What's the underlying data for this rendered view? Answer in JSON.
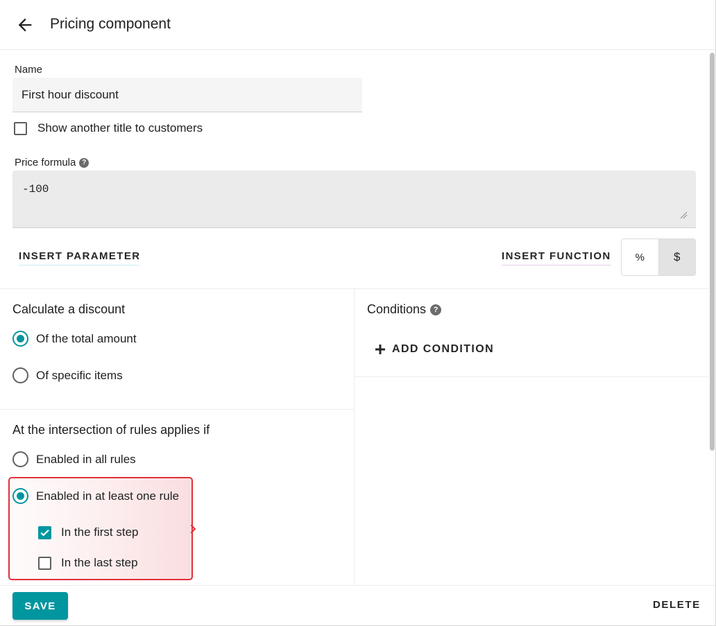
{
  "header": {
    "title": "Pricing component",
    "back_icon": "arrow-left-icon"
  },
  "name_field": {
    "label": "Name",
    "value": "First hour discount"
  },
  "show_title_option": {
    "label": "Show another title to customers",
    "checked": false
  },
  "price_formula": {
    "label": "Price formula",
    "help_icon": "question-circle-icon",
    "value": "-100"
  },
  "actions": {
    "insert_parameter": "INSERT PARAMETER",
    "insert_function": "INSERT FUNCTION"
  },
  "unit_toggle": {
    "options": [
      "%",
      "$"
    ],
    "selected": "$"
  },
  "discount": {
    "title": "Calculate a discount",
    "options": [
      {
        "label": "Of the total amount",
        "checked": true
      },
      {
        "label": "Of specific items",
        "checked": false
      }
    ]
  },
  "conditions": {
    "title": "Conditions",
    "help_icon": "question-circle-icon",
    "add_label": "ADD CONDITION",
    "add_icon": "plus-icon"
  },
  "intersection": {
    "title": "At the intersection of rules applies if",
    "options": [
      {
        "label": "Enabled in all rules",
        "checked": false
      },
      {
        "label": "Enabled in at least one rule",
        "checked": true
      }
    ],
    "steps": [
      {
        "label": "In the first step",
        "checked": true
      },
      {
        "label": "In the last step",
        "checked": false
      }
    ]
  },
  "footer": {
    "save": "SAVE",
    "delete": "DELETE"
  },
  "colors": {
    "accent": "#00969f",
    "highlight_border": "#e0303a"
  }
}
